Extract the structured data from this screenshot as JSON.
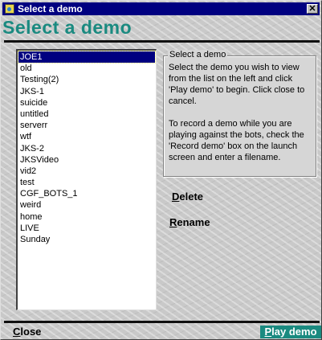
{
  "window": {
    "title": "Select a demo",
    "close_glyph": "✕"
  },
  "heading": "Select a demo",
  "demo_list": {
    "items": [
      "JOE1",
      "old",
      "Testing(2)",
      "JKS-1",
      "suicide",
      "untitled",
      "serverr",
      "wtf",
      "JKS-2",
      "JKSVideo",
      "vid2",
      "test",
      "CGF_BOTS_1",
      "weird",
      "home",
      "LIVE",
      "Sunday"
    ],
    "selected": "JOE1"
  },
  "info_group": {
    "title": "Select a demo",
    "paragraph1": "Select the demo you wish to view from the list on the left and click 'Play demo' to begin. Click close to cancel.",
    "paragraph2": "To record a demo while you are playing against the bots, check the 'Record demo' box on the launch screen and enter a filename."
  },
  "actions": {
    "delete": {
      "accel": "D",
      "rest": "elete"
    },
    "rename": {
      "accel": "R",
      "rest": "ename"
    }
  },
  "footer": {
    "close": {
      "accel": "C",
      "rest": "lose"
    },
    "play": {
      "accel": "P",
      "rest": "lay demo"
    }
  },
  "colors": {
    "accent": "#1a8a80",
    "titlebar": "#000080",
    "selection": "#000080"
  }
}
